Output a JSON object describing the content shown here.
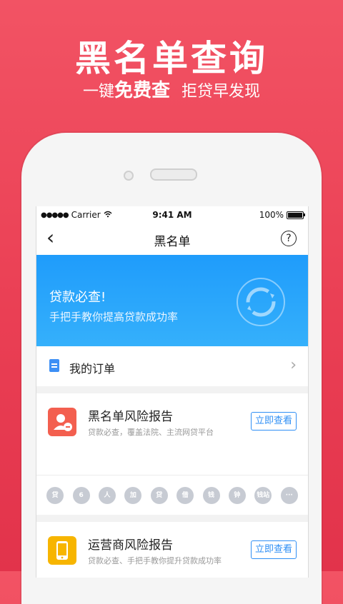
{
  "hero": {
    "title": "黑名单查询",
    "sub_prefix": "一键",
    "sub_strong": "免费查",
    "sub_suffix": "拒贷早发现"
  },
  "status_bar": {
    "carrier": "Carrier",
    "time": "9:41 AM",
    "battery": "100%"
  },
  "nav": {
    "back_glyph": "‹",
    "title": "黑名单",
    "help_glyph": "?"
  },
  "banner": {
    "title": "贷款必查!",
    "subtitle": "手把手教你提高贷款成功率"
  },
  "orders": {
    "label": "我的订单",
    "chevron": "›"
  },
  "reports": [
    {
      "title": "黑名单风险报告",
      "desc": "贷款必查，覆盖法院、主流网贷平台",
      "button": "立即查看",
      "icon": "user-minus-icon",
      "color": "#f35f4f"
    },
    {
      "title": "运营商风险报告",
      "desc": "贷款必查、手把手教你提升贷款成功率",
      "button": "立即查看",
      "icon": "phone-icon",
      "color": "#f7b500"
    }
  ],
  "partner_logos": [
    "贷",
    "6",
    "人",
    "加",
    "贷",
    "借",
    "钱",
    "钟",
    "钱站",
    "···"
  ]
}
